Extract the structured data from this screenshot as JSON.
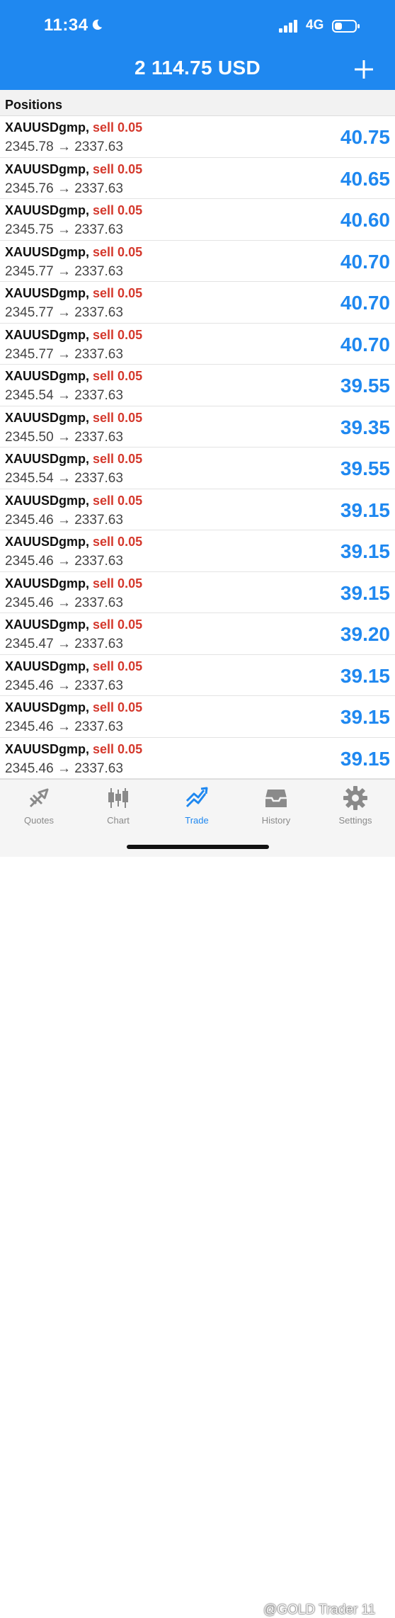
{
  "status_bar": {
    "time": "11:34",
    "network": "4G"
  },
  "header": {
    "balance": "2 114.75 USD",
    "add_icon": "plus-icon"
  },
  "section": {
    "title": "Positions"
  },
  "positions": [
    {
      "symbol": "XAUUSDgmp,",
      "side": "sell 0.05",
      "prices": "2345.78 → 2337.63",
      "profit": "40.75"
    },
    {
      "symbol": "XAUUSDgmp,",
      "side": "sell 0.05",
      "prices": "2345.76 → 2337.63",
      "profit": "40.65"
    },
    {
      "symbol": "XAUUSDgmp,",
      "side": "sell 0.05",
      "prices": "2345.75 → 2337.63",
      "profit": "40.60"
    },
    {
      "symbol": "XAUUSDgmp,",
      "side": "sell 0.05",
      "prices": "2345.77 → 2337.63",
      "profit": "40.70"
    },
    {
      "symbol": "XAUUSDgmp,",
      "side": "sell 0.05",
      "prices": "2345.77 → 2337.63",
      "profit": "40.70"
    },
    {
      "symbol": "XAUUSDgmp,",
      "side": "sell 0.05",
      "prices": "2345.77 → 2337.63",
      "profit": "40.70"
    },
    {
      "symbol": "XAUUSDgmp,",
      "side": "sell 0.05",
      "prices": "2345.54 → 2337.63",
      "profit": "39.55"
    },
    {
      "symbol": "XAUUSDgmp,",
      "side": "sell 0.05",
      "prices": "2345.50 → 2337.63",
      "profit": "39.35"
    },
    {
      "symbol": "XAUUSDgmp,",
      "side": "sell 0.05",
      "prices": "2345.54 → 2337.63",
      "profit": "39.55"
    },
    {
      "symbol": "XAUUSDgmp,",
      "side": "sell 0.05",
      "prices": "2345.46 → 2337.63",
      "profit": "39.15"
    },
    {
      "symbol": "XAUUSDgmp,",
      "side": "sell 0.05",
      "prices": "2345.46 → 2337.63",
      "profit": "39.15"
    },
    {
      "symbol": "XAUUSDgmp,",
      "side": "sell 0.05",
      "prices": "2345.46 → 2337.63",
      "profit": "39.15"
    },
    {
      "symbol": "XAUUSDgmp,",
      "side": "sell 0.05",
      "prices": "2345.47 → 2337.63",
      "profit": "39.20"
    },
    {
      "symbol": "XAUUSDgmp,",
      "side": "sell 0.05",
      "prices": "2345.46 → 2337.63",
      "profit": "39.15"
    },
    {
      "symbol": "XAUUSDgmp,",
      "side": "sell 0.05",
      "prices": "2345.46 → 2337.63",
      "profit": "39.15"
    },
    {
      "symbol": "XAUUSDgmp,",
      "side": "sell 0.05",
      "prices": "2345.46 → 2337.63",
      "profit": "39.15"
    }
  ],
  "tabbar": {
    "tabs": [
      {
        "label": "Quotes",
        "icon": "quotes-icon",
        "active": false
      },
      {
        "label": "Chart",
        "icon": "candlestick-chart-icon",
        "active": false
      },
      {
        "label": "Trade",
        "icon": "trade-trend-icon",
        "active": true
      },
      {
        "label": "History",
        "icon": "history-inbox-icon",
        "active": false
      },
      {
        "label": "Settings",
        "icon": "gear-icon",
        "active": false
      }
    ]
  },
  "watermark": {
    "text": "@GOLD Trader 11"
  },
  "colors": {
    "accent": "#1f88f0",
    "sell": "#d4382c",
    "tab_inactive": "#8a8a8a"
  }
}
